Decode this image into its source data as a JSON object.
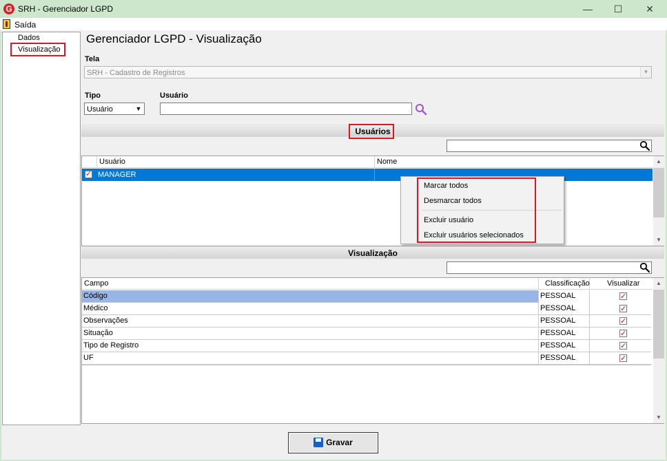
{
  "window": {
    "title": "SRH - Gerenciador LGPD",
    "app_icon_letter": "G",
    "min_glyph": "—",
    "max_glyph": "☐",
    "close_glyph": "✕"
  },
  "menu": {
    "exit_label": "Saída"
  },
  "tree": {
    "items": [
      {
        "label": "Dados"
      },
      {
        "label": "Visualização"
      }
    ]
  },
  "page": {
    "title": "Gerenciador LGPD - Visualização"
  },
  "form": {
    "tela_label": "Tela",
    "tela_value": "SRH - Cadastro de Registros",
    "tipo_label": "Tipo",
    "tipo_value": "Usuário",
    "usuario_label": "Usuário",
    "usuario_value": ""
  },
  "users_section": {
    "title": "Usuários",
    "columns": [
      "Usuário",
      "Nome"
    ],
    "rows": [
      {
        "usuario": "MANAGER",
        "nome": "",
        "checked": true
      }
    ]
  },
  "context_menu": {
    "items": [
      "Marcar todos",
      "Desmarcar todos",
      "Excluir usuário",
      "Excluir usuários selecionados"
    ]
  },
  "vis_section": {
    "title": "Visualização",
    "columns": [
      "Campo",
      "Classificação",
      "Visualizar"
    ],
    "rows": [
      {
        "campo": "Código",
        "classificacao": "PESSOAL",
        "visualizar": true
      },
      {
        "campo": "Médico",
        "classificacao": "PESSOAL",
        "visualizar": true
      },
      {
        "campo": "Observações",
        "classificacao": "PESSOAL",
        "visualizar": true
      },
      {
        "campo": "Situação",
        "classificacao": "PESSOAL",
        "visualizar": true
      },
      {
        "campo": "Tipo de Registro",
        "classificacao": "PESSOAL",
        "visualizar": true
      },
      {
        "campo": "UF",
        "classificacao": "PESSOAL",
        "visualizar": true
      }
    ]
  },
  "footer": {
    "save_label": "Gravar"
  },
  "colors": {
    "accent_red": "#e0141e",
    "selection_blue": "#0078d7",
    "row_highlight": "#99b4e6",
    "search_purple": "#9b59d0"
  }
}
